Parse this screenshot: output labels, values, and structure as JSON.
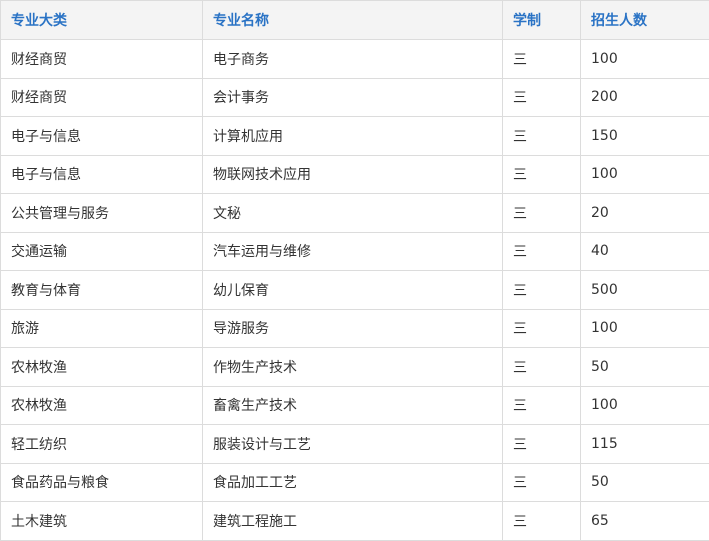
{
  "colors": {
    "header_text": "#2a73c5",
    "header_bg": "#f4f4f4",
    "border": "#dcdcdc",
    "body_text": "#333333"
  },
  "table": {
    "headers": [
      "专业大类",
      "专业名称",
      "学制",
      "招生人数"
    ],
    "rows": [
      [
        "财经商贸",
        "电子商务",
        "三",
        "100"
      ],
      [
        "财经商贸",
        "会计事务",
        "三",
        "200"
      ],
      [
        "电子与信息",
        "计算机应用",
        "三",
        "150"
      ],
      [
        "电子与信息",
        "物联网技术应用",
        "三",
        "100"
      ],
      [
        "公共管理与服务",
        "文秘",
        "三",
        "20"
      ],
      [
        "交通运输",
        "汽车运用与维修",
        "三",
        "40"
      ],
      [
        "教育与体育",
        "幼儿保育",
        "三",
        "500"
      ],
      [
        "旅游",
        "导游服务",
        "三",
        "100"
      ],
      [
        "农林牧渔",
        "作物生产技术",
        "三",
        "50"
      ],
      [
        "农林牧渔",
        "畜禽生产技术",
        "三",
        "100"
      ],
      [
        "轻工纺织",
        "服装设计与工艺",
        "三",
        "115"
      ],
      [
        "食品药品与粮食",
        "食品加工工艺",
        "三",
        "50"
      ],
      [
        "土木建筑",
        "建筑工程施工",
        "三",
        "65"
      ]
    ]
  }
}
